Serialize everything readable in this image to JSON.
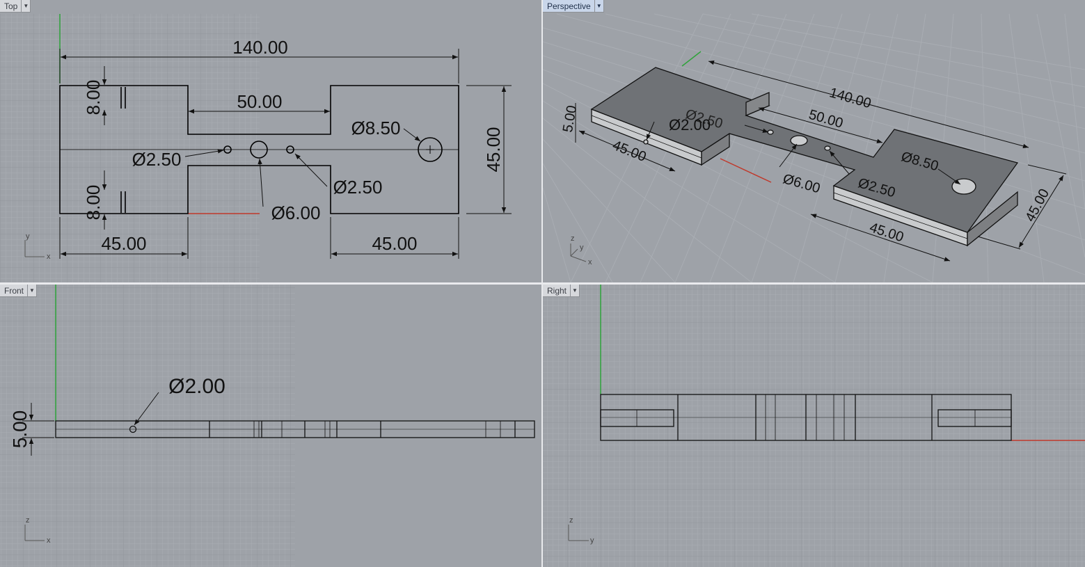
{
  "viewports": {
    "top": {
      "title": "Top",
      "dims": {
        "overall_width": "140.00",
        "slot_width": "50.00",
        "hole_large_right": "Ø8.50",
        "height_right": "45.00",
        "hole_small_left": "Ø2.50",
        "hole_small_right": "Ø2.50",
        "hole_center": "Ø6.00",
        "notch_top": "8.00",
        "notch_bottom": "8.00",
        "left_width": "45.00",
        "right_width": "45.00"
      },
      "axes": {
        "x": "x",
        "y": "y"
      }
    },
    "perspective": {
      "title": "Perspective",
      "dims": {
        "overall_width": "140.00",
        "slot_width": "50.00",
        "hole_small_a": "Ø2.50",
        "hole_pin": "Ø2.00",
        "thickness": "5.00",
        "left_width": "45.00",
        "hole_center": "Ø6.00",
        "hole_small_b": "Ø2.50",
        "hole_large": "Ø8.50",
        "right_width": "45.00",
        "depth": "45.00"
      },
      "axes": {
        "x": "x",
        "y": "y",
        "z": "z"
      }
    },
    "front": {
      "title": "Front",
      "dims": {
        "hole_pin": "Ø2.00",
        "thickness": "5.00"
      },
      "axes": {
        "x": "x",
        "z": "z"
      }
    },
    "right": {
      "title": "Right",
      "axes": {
        "y": "y",
        "z": "z"
      }
    }
  },
  "icons": {
    "dropdown": "chevron-down-icon"
  },
  "colors": {
    "background": "#9ea2a8",
    "grid_minor": "#a9adb3",
    "grid_major": "#8f9399",
    "axis_x": "#c0392b",
    "axis_y": "#2fa33a",
    "geometry": "#000000",
    "active_tab": "#c9d6ea"
  }
}
